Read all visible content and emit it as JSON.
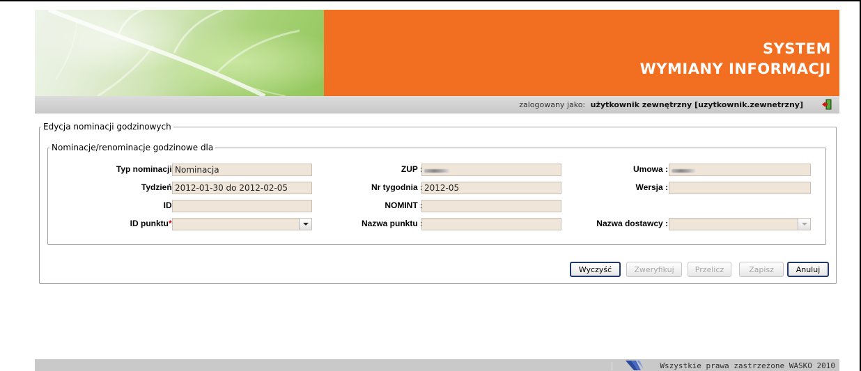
{
  "header": {
    "brand_line1": "SYSTEM",
    "brand_line2": "WYMIANY INFORMACJI",
    "logged_as_label": "zalogowany jako:",
    "user_name": "użytkownik zewnętrzny [uzytkownik.zewnetrzny]",
    "logout_icon": "logout-door-icon"
  },
  "form": {
    "outer_legend": "Edycja nominacji godzinowych",
    "inner_legend": "Nominacje/renominacje godzinowe dla",
    "fields": {
      "typ_nominacji": {
        "label": "Typ nominacji :",
        "value": "Nominacja"
      },
      "tydzien": {
        "label": "Tydzień :",
        "value": "2012-01-30 do 2012-02-05"
      },
      "id": {
        "label": "ID :",
        "value": ""
      },
      "id_punktu": {
        "label": "ID punktu",
        "required_mark": "*",
        "colon": " :",
        "value": ""
      },
      "zup": {
        "label": "ZUP :",
        "value": ""
      },
      "nr_tygodnia": {
        "label": "Nr tygodnia :",
        "value": "2012-05"
      },
      "nomint": {
        "label": "NOMINT :",
        "value": ""
      },
      "nazwa_punktu": {
        "label": "Nazwa punktu :",
        "value": ""
      },
      "umowa": {
        "label": "Umowa :",
        "value": ""
      },
      "wersja": {
        "label": "Wersja :",
        "value": ""
      },
      "nazwa_dostawcy": {
        "label": "Nazwa dostawcy :",
        "value": ""
      }
    }
  },
  "buttons": {
    "clear": "Wyczyść",
    "verify": "Zweryfikuj",
    "recalc": "Przelicz",
    "save": "Zapisz",
    "cancel": "Anuluj"
  },
  "footer": {
    "copyright": "Wszystkie prawa zastrzeżone WASKO 2010"
  },
  "colors": {
    "banner_orange": "#f26f22",
    "field_bg": "#efe5d8",
    "required": "#d40000"
  }
}
